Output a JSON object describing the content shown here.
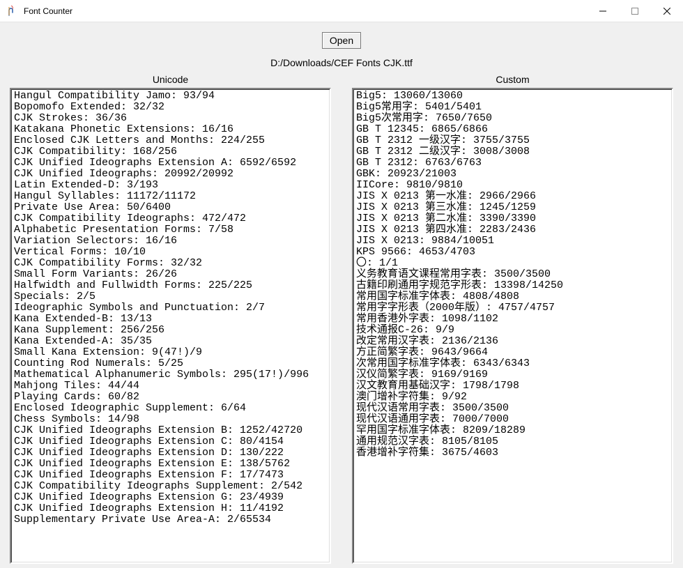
{
  "window": {
    "title": "Font Counter"
  },
  "toolbar": {
    "open_label": "Open"
  },
  "file_path": "D:/Downloads/CEF Fonts CJK.ttf",
  "headers": {
    "unicode": "Unicode",
    "custom": "Custom"
  },
  "unicode_lines": [
    "Hangul Compatibility Jamo: 93/94",
    "Bopomofo Extended: 32/32",
    "CJK Strokes: 36/36",
    "Katakana Phonetic Extensions: 16/16",
    "Enclosed CJK Letters and Months: 224/255",
    "CJK Compatibility: 168/256",
    "CJK Unified Ideographs Extension A: 6592/6592",
    "CJK Unified Ideographs: 20992/20992",
    "Latin Extended-D: 3/193",
    "Hangul Syllables: 11172/11172",
    "Private Use Area: 50/6400",
    "CJK Compatibility Ideographs: 472/472",
    "Alphabetic Presentation Forms: 7/58",
    "Variation Selectors: 16/16",
    "Vertical Forms: 10/10",
    "CJK Compatibility Forms: 32/32",
    "Small Form Variants: 26/26",
    "Halfwidth and Fullwidth Forms: 225/225",
    "Specials: 2/5",
    "Ideographic Symbols and Punctuation: 2/7",
    "Kana Extended-B: 13/13",
    "Kana Supplement: 256/256",
    "Kana Extended-A: 35/35",
    "Small Kana Extension: 9(47!)/9",
    "Counting Rod Numerals: 5/25",
    "Mathematical Alphanumeric Symbols: 295(17!)/996",
    "Mahjong Tiles: 44/44",
    "Playing Cards: 60/82",
    "Enclosed Ideographic Supplement: 6/64",
    "Chess Symbols: 14/98",
    "CJK Unified Ideographs Extension B: 1252/42720",
    "CJK Unified Ideographs Extension C: 80/4154",
    "CJK Unified Ideographs Extension D: 130/222",
    "CJK Unified Ideographs Extension E: 138/5762",
    "CJK Unified Ideographs Extension F: 17/7473",
    "CJK Compatibility Ideographs Supplement: 2/542",
    "CJK Unified Ideographs Extension G: 23/4939",
    "CJK Unified Ideographs Extension H: 11/4192",
    "Supplementary Private Use Area-A: 2/65534"
  ],
  "custom_lines": [
    "Big5: 13060/13060",
    "Big5常用字: 5401/5401",
    "Big5次常用字: 7650/7650",
    "GB T 12345: 6865/6866",
    "GB T 2312 一级汉字: 3755/3755",
    "GB T 2312 二级汉字: 3008/3008",
    "GB T 2312: 6763/6763",
    "GBK: 20923/21003",
    "IICore: 9810/9810",
    "JIS X 0213 第一水准: 2966/2966",
    "JIS X 0213 第三水准: 1245/1259",
    "JIS X 0213 第二水准: 3390/3390",
    "JIS X 0213 第四水准: 2283/2436",
    "JIS X 0213: 9884/10051",
    "KPS 9566: 4653/4703",
    "〇: 1/1",
    "义务教育语文课程常用字表: 3500/3500",
    "古籍印刷通用字规范字形表: 13398/14250",
    "常用国字标准字体表: 4808/4808",
    "常用字字形表（2000年版）: 4757/4757",
    "常用香港外字表: 1098/1102",
    "技术通报C-26: 9/9",
    "改定常用汉字表: 2136/2136",
    "方正简繁字表: 9643/9664",
    "次常用国字标准字体表: 6343/6343",
    "汉仪简繁字表: 9169/9169",
    "汉文教育用基础汉字: 1798/1798",
    "澳门增补字符集: 9/92",
    "现代汉语常用字表: 3500/3500",
    "现代汉语通用字表: 7000/7000",
    "罕用国字标准字体表: 8209/18289",
    "通用规范汉字表: 8105/8105",
    "香港增补字符集: 3675/4603"
  ]
}
